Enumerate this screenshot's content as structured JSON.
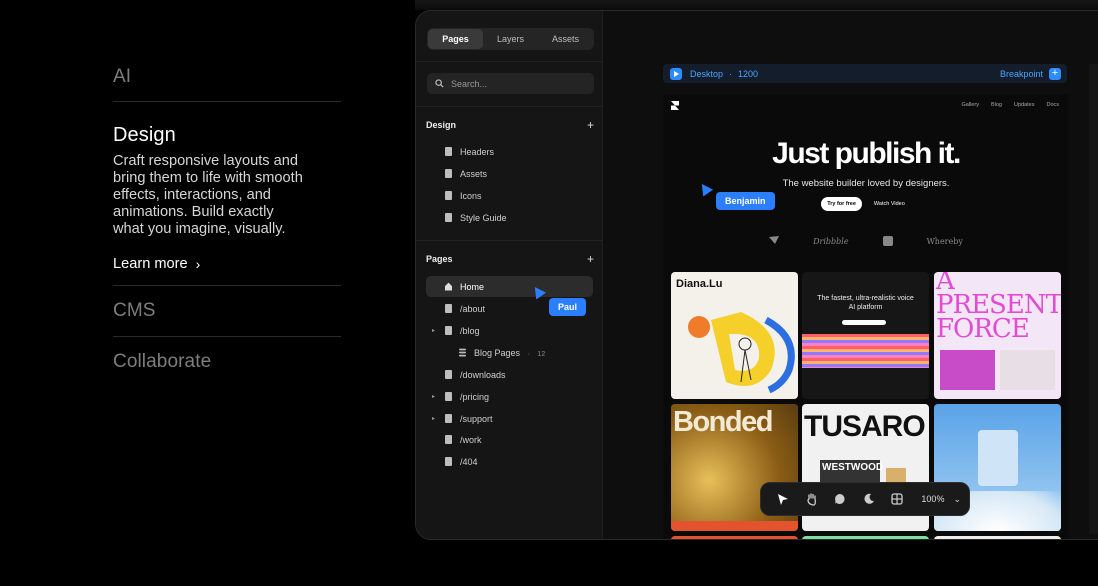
{
  "features": {
    "ai": {
      "title": "AI"
    },
    "design": {
      "title": "Design",
      "description": "Craft responsive layouts and bring them to life with smooth effects, interactions, and animations. Build exactly what you imagine, visually.",
      "learn_more": "Learn more",
      "chevron": "›"
    },
    "cms": {
      "title": "CMS"
    },
    "collaborate": {
      "title": "Collaborate"
    }
  },
  "sidebar": {
    "tabs": [
      {
        "label": "Pages",
        "active": true
      },
      {
        "label": "Layers",
        "active": false
      },
      {
        "label": "Assets",
        "active": false
      }
    ],
    "search": {
      "placeholder": "Search..."
    },
    "design_section": {
      "title": "Design",
      "plus": "+",
      "items": [
        "Headers",
        "Assets",
        "Icons",
        "Style Guide"
      ]
    },
    "pages_section": {
      "title": "Pages",
      "plus": "+",
      "items": [
        {
          "label": "Home",
          "icon": "home-icon",
          "active": true
        },
        {
          "label": "/about",
          "icon": "page-icon"
        },
        {
          "label": "/blog",
          "icon": "page-icon",
          "caret": "▸"
        },
        {
          "label": "Blog Pages",
          "icon": "database-icon",
          "sub": true,
          "dot": "·",
          "count": "12"
        },
        {
          "label": "/downloads",
          "icon": "page-icon"
        },
        {
          "label": "/pricing",
          "icon": "page-icon",
          "caret": "▸"
        },
        {
          "label": "/support",
          "icon": "page-icon",
          "caret": "▸"
        },
        {
          "label": "/work",
          "icon": "page-icon"
        },
        {
          "label": "/404",
          "icon": "page-icon"
        }
      ]
    }
  },
  "breakpoint_bar": {
    "device": "Desktop",
    "dot": "·",
    "width": "1200",
    "right_label": "Breakpoint",
    "plus": "+",
    "accent": "#2d8cff"
  },
  "preview": {
    "nav": [
      "Gallery",
      "Blog",
      "Updates",
      "Docs"
    ],
    "hero_title": "Just publish it.",
    "hero_subtitle": "The website builder loved by designers.",
    "primary_button": "Try for free",
    "secondary_button": "Watch Video",
    "logos": [
      "Dribbble",
      "Whereby"
    ],
    "cards": {
      "diana": "Diana.Lu",
      "voice_headline": "The fastest, ultra-realistic voice AI platform",
      "present_force": "A PRESENT FORCE",
      "bonded": "Bonded",
      "tusaro": "TUSARO",
      "westwood": "WESTWOOD"
    }
  },
  "cursors": [
    {
      "name": "Benjamin",
      "color": "#2b7fff"
    },
    {
      "name": "Paul",
      "color": "#2b7fff"
    }
  ],
  "toolbar": {
    "tools": [
      "select-icon",
      "hand-icon",
      "comment-icon",
      "dark-mode-icon",
      "grid-icon"
    ],
    "zoom": "100%",
    "zoom_chevron": "⌄"
  }
}
